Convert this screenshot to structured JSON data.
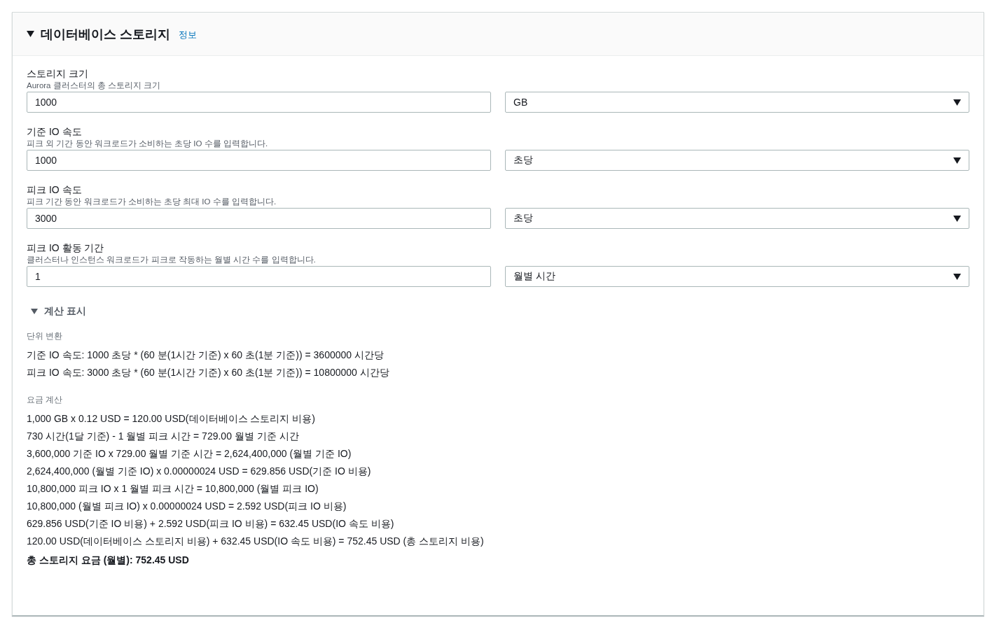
{
  "section": {
    "title": "데이터베이스 스토리지",
    "info_link": "정보",
    "expanded": true
  },
  "fields": [
    {
      "label": "스토리지 크기",
      "description": "Aurora 클러스터의 총 스토리지 크기",
      "value": "1000",
      "unit": "GB"
    },
    {
      "label": "기준 IO 속도",
      "description": "피크 외 기간 동안 워크로드가 소비하는 초당 IO 수를 입력합니다.",
      "value": "1000",
      "unit": "초당"
    },
    {
      "label": "피크 IO 속도",
      "description": "피크 기간 동안 워크로드가 소비하는 초당 최대 IO 수를 입력합니다.",
      "value": "3000",
      "unit": "초당"
    },
    {
      "label": "피크 IO 활동 기간",
      "description": "클러스터나 인스턴스 워크로드가 피크로 작동하는 월별 시간 수를 입력합니다.",
      "value": "1",
      "unit": "월별 시간"
    }
  ],
  "calculation": {
    "toggle_label": "계산 표시",
    "expanded": true,
    "groups": [
      {
        "heading": "단위 변환",
        "lines": [
          "기준 IO 속도: 1000 초당 * (60 분(1시간 기준) x 60 초(1분 기준)) = 3600000 시간당",
          "피크 IO 속도: 3000 초당 * (60 분(1시간 기준) x 60 초(1분 기준)) = 10800000 시간당"
        ]
      },
      {
        "heading": "요금 계산",
        "lines": [
          "1,000 GB x 0.12 USD = 120.00 USD(데이터베이스 스토리지 비용)",
          "730 시간(1달 기준) - 1 월별 피크 시간 = 729.00 월별 기준 시간",
          "3,600,000 기준 IO x 729.00 월별 기준 시간 = 2,624,400,000 (월별 기준 IO)",
          "2,624,400,000 (월별 기준 IO) x 0.00000024 USD = 629.856 USD(기준 IO 비용)",
          "10,800,000 피크 IO x 1 월별 피크 시간 = 10,800,000 (월별 피크 IO)",
          "10,800,000 (월별 피크 IO) x 0.00000024 USD = 2.592 USD(피크 IO 비용)",
          "629.856 USD(기준 IO 비용) + 2.592 USD(피크 IO 비용) = 632.45 USD(IO 속도 비용)",
          "120.00 USD(데이터베이스 스토리지 비용) + 632.45 USD(IO 속도 비용) = 752.45 USD (총 스토리지 비용)"
        ]
      }
    ],
    "total": "총 스토리지 요금 (월별): 752.45 USD"
  }
}
